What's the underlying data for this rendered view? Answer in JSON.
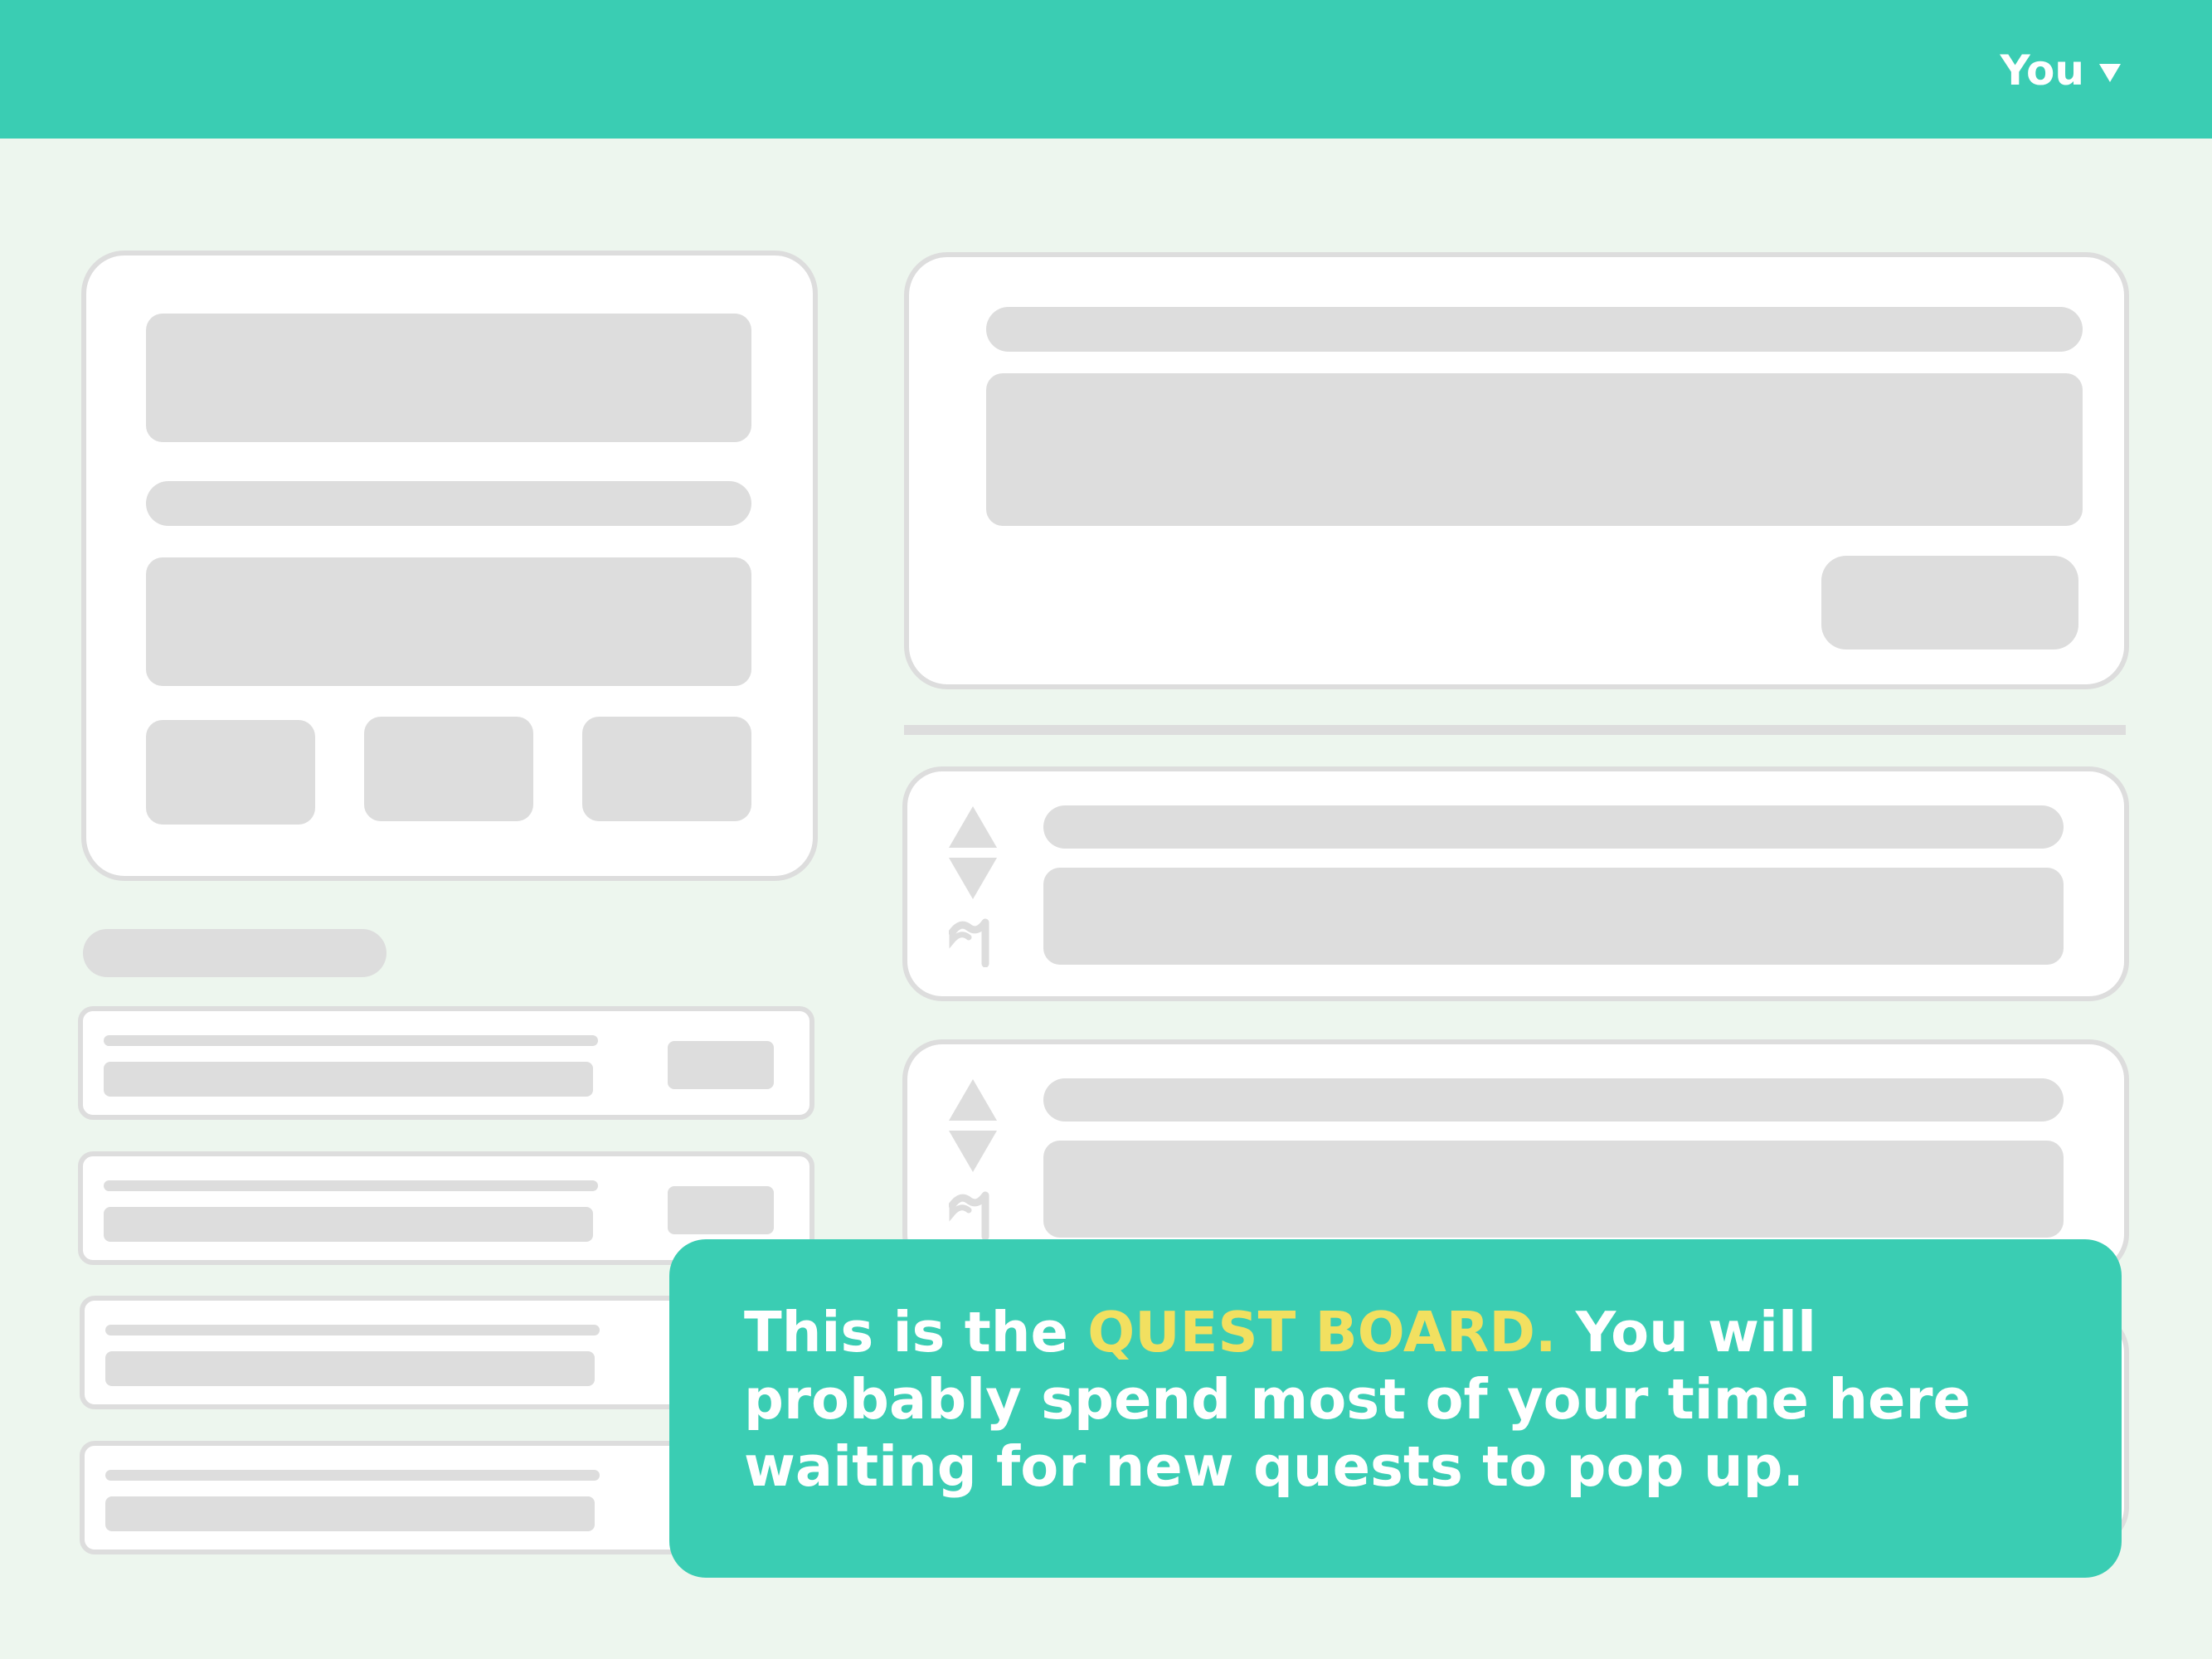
{
  "header": {
    "user_label": "You",
    "accent_color": "#3acdb3"
  },
  "tooltip": {
    "text_before": "This is the ",
    "highlight": "QUEST BOARD.",
    "text_after": " You will probably spend most of your time here waiting for new quests to pop up.",
    "highlight_color": "#f2e060"
  },
  "icons": {
    "user_menu": "chevron-down-icon",
    "upvote": "upvote-triangle-icon",
    "downvote": "downvote-triangle-icon",
    "report": "flag-icon"
  }
}
